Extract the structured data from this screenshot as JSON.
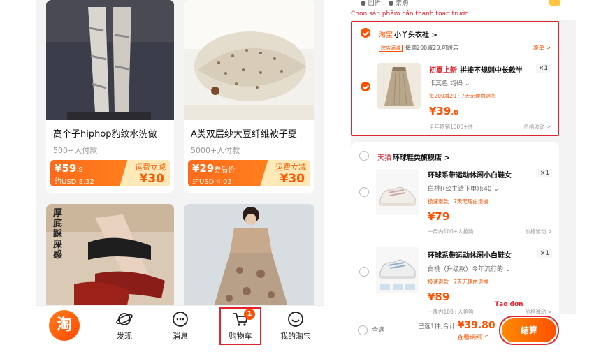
{
  "left_phone": {
    "products": [
      {
        "title": "高个子hiphop豹纹水洗做",
        "sold": "500+人付款",
        "price_int": "¥59",
        "price_dec": ".9",
        "usd": "约USD 8.32",
        "promo_line1": "运费立减",
        "promo_line2": "¥30"
      },
      {
        "title": "A类双层纱大豆纤维被子夏",
        "sold": "5000+人付款",
        "price_int": "¥29",
        "price_dec": "券后价",
        "usd": "约USD 4.03",
        "promo_line1": "运费立减",
        "promo_line2": "¥30"
      },
      {
        "image_text": "厚底 踩屎感"
      },
      {}
    ],
    "tabbar": {
      "home": "淘",
      "discover": "发现",
      "messages": "消息",
      "cart": "购物车",
      "cart_badge": "1",
      "me": "我的淘宝"
    }
  },
  "right_phone": {
    "chips": [
      "● 回折",
      "● 亲购"
    ],
    "hint": "Chọn sản phẩm cần thanh toán trước",
    "shop1": {
      "brand": "淘宝",
      "name": "小丫头衣社 >",
      "tag_box": "跨店满减",
      "tag_text": "每满200减20,可跨店",
      "coupon_link": "凑单 >",
      "item": {
        "tag": "初夏上新",
        "name": "拼接不规则中长款半",
        "qty": "×1",
        "sku": "卡其色;均码 ⌄",
        "promo": "每200减20 · 7天无理由退货",
        "price": "¥39",
        "price_dec": ".8",
        "meta": "全年畅销1000+件",
        "wave": "价格波动 >"
      }
    },
    "shop2": {
      "brand": "天猫",
      "name": "环球鞋类旗舰店 >",
      "items": [
        {
          "name": "环球系带运动休闲小白鞋女",
          "qty": "×1",
          "sku": "白桃[(公主请下单)];40 ⌄",
          "promo": "极速退款 · 7天无理由退换",
          "price": "¥79",
          "meta": "一周内100+人抢购",
          "wave": "价格波动 >"
        },
        {
          "name": "环球系带运动休闲小白鞋女",
          "qty": "×1",
          "sku": "白桃（升级款）今年流行的 ⌄",
          "promo": "极速退款 · 7天无理由退换",
          "price": "¥89",
          "meta": "一周内100+人抢购",
          "wave": "价格波动 >"
        }
      ]
    },
    "bottom": {
      "select_all": "全选",
      "summary_prefix": "已选1件,合计:",
      "amount": "¥39.80",
      "detail": "查看明细 ^",
      "checkout": "结算",
      "annotation": "Tạo đơn"
    }
  },
  "colors": {
    "accent": "#ff5000",
    "highlight": "#e0252f"
  }
}
